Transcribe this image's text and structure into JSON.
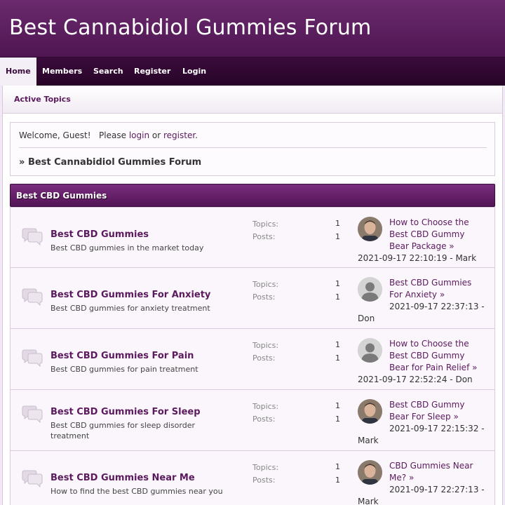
{
  "header": {
    "title": "Best Cannabidiol Gummies Forum"
  },
  "nav": {
    "items": [
      "Home",
      "Members",
      "Search",
      "Register",
      "Login"
    ]
  },
  "subnav": {
    "label": "Active Topics"
  },
  "welcome": {
    "greeting": "Welcome, Guest!",
    "please": "Please",
    "login": "login",
    "or": "or",
    "register": "register",
    "period": ".",
    "breadcrumb_arrow": "»",
    "breadcrumb": "Best Cannabidiol Gummies Forum"
  },
  "category": {
    "title": "Best CBD Gummies"
  },
  "labels": {
    "topics": "Topics:",
    "posts": "Posts:",
    "arrow": "»",
    "dash": "-"
  },
  "boards": [
    {
      "title": "Best CBD Gummies",
      "desc": "Best CBD gummies in the market today",
      "topics": "1",
      "posts": "1",
      "last_topic_l1": "How to Choose the",
      "last_topic_l2": "Best CBD Gummy",
      "last_topic_l3": "Bear Package",
      "date": "2021-09-17 22:10:19",
      "user": "Mark",
      "avatar": "photo"
    },
    {
      "title": "Best CBD Gummies For Anxiety",
      "desc": "Best CBD gummies for anxiety treatment",
      "topics": "1",
      "posts": "1",
      "last_topic_l1": "Best CBD Gummies",
      "last_topic_l2": "For Anxiety",
      "date": "2021-09-17 22:37:13",
      "user": "Don",
      "avatar": "default"
    },
    {
      "title": "Best CBD Gummies For Pain",
      "desc": "Best CBD gummies for pain treatment",
      "topics": "1",
      "posts": "1",
      "last_topic_l1": "How to Choose the",
      "last_topic_l2": "Best CBD Gummy",
      "last_topic_l3": "Bear for Pain Relief",
      "date": "2021-09-17 22:52:24",
      "user": "Don",
      "avatar": "default"
    },
    {
      "title": "Best CBD Gummies For Sleep",
      "desc_l1": "Best CBD gummies for sleep disorder",
      "desc_l2": "treatment",
      "topics": "1",
      "posts": "1",
      "last_topic_l1": "Best CBD Gummy",
      "last_topic_l2": "Bear For Sleep",
      "date": "2021-09-17 22:15:32",
      "user": "Mark",
      "avatar": "photo"
    },
    {
      "title": "Best CBD Gummies Near Me",
      "desc": "How to find the best CBD gummies near you",
      "topics": "1",
      "posts": "1",
      "last_topic_l1": "CBD Gummies Near",
      "last_topic_l2": "Me?",
      "date": "2021-09-17 22:27:13",
      "user": "Mark",
      "avatar": "photo"
    }
  ],
  "colors": {
    "brand": "#5b1a5e",
    "header_bg": "#4f1552",
    "nav_bg": "#2e0830"
  },
  "icons": {
    "board": "speech-bubbles-icon",
    "avatar_default": "user-silhouette-icon"
  }
}
